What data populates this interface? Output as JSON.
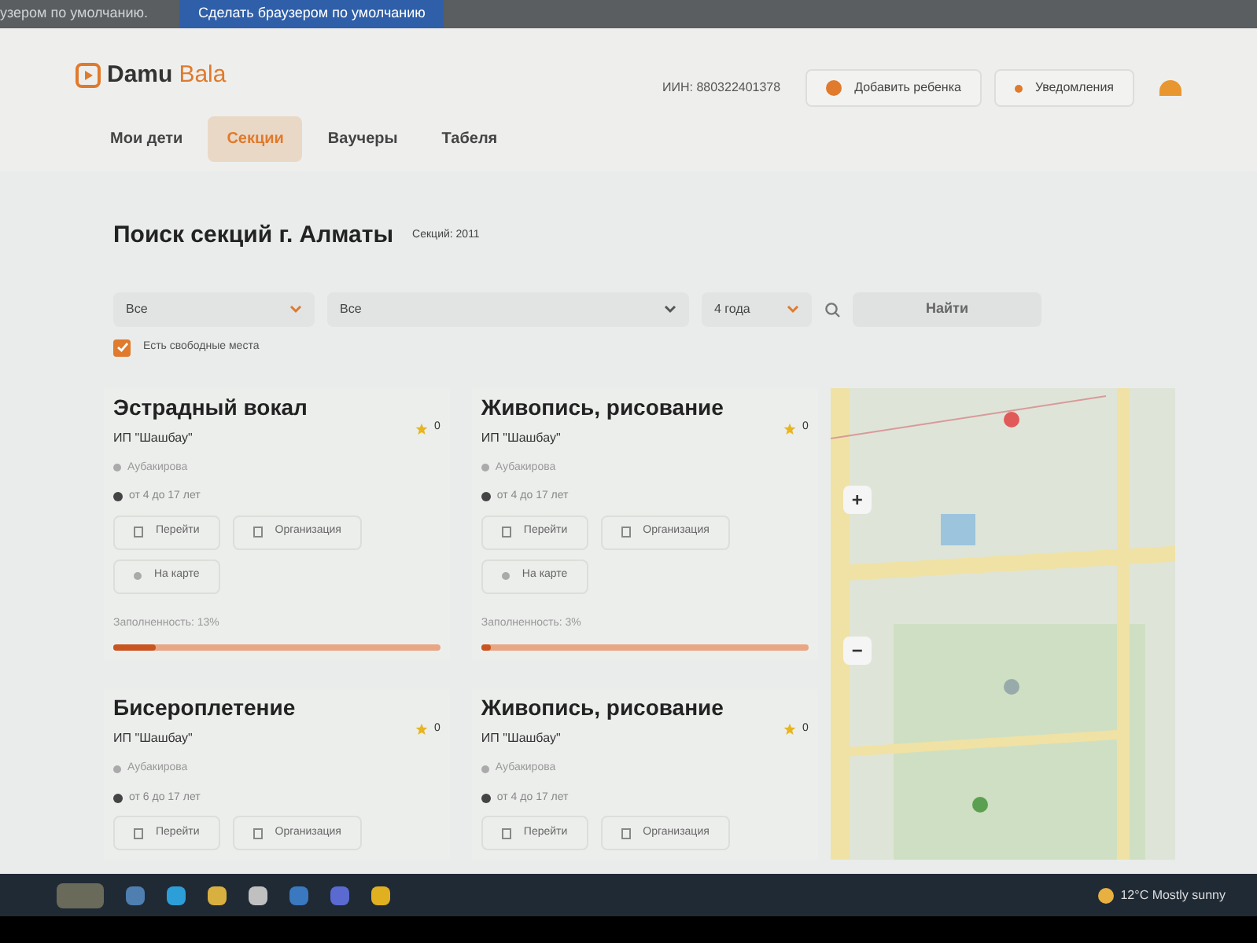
{
  "browser_infobar": {
    "message": "узером по умолчанию.",
    "button": "Сделать браузером по умолчанию"
  },
  "header": {
    "logo_first": "Damu",
    "logo_second": "Bala",
    "iin": "ИИН: 880322401378",
    "add_child": "Добавить ребенка",
    "notifications": "Уведомления"
  },
  "tabs": [
    {
      "label": "Мои дети",
      "selected": false
    },
    {
      "label": "Секции",
      "selected": true
    },
    {
      "label": "Ваучеры",
      "selected": false
    },
    {
      "label": "Табеля",
      "selected": false
    }
  ],
  "search": {
    "title": "Поиск секций г. Алматы",
    "count": "Секций: 2011",
    "filter_1": "Все",
    "filter_2": "Все",
    "age": "4 года",
    "button": "Найти",
    "free_places": {
      "label": "Есть свободные места",
      "checked": true
    }
  },
  "cards": [
    {
      "title": "Эстрадный вокал",
      "org": "ИП \"Шашбау\"",
      "rating": "0",
      "address": "Аубакирова",
      "age": "от 4 до 17 лет",
      "buttons": [
        "Перейти",
        "Организация",
        "На карте"
      ],
      "fill_label": "Заполненность: 13%",
      "level": 0.13
    },
    {
      "title": "Живопись, рисование",
      "org": "ИП \"Шашбау\"",
      "rating": "0",
      "address": "Аубакирова",
      "age": "от 4 до 17 лет",
      "buttons": [
        "Перейти",
        "Организация",
        "На карте"
      ],
      "fill_label": "Заполненность: 3%",
      "level": 0.03
    },
    {
      "title": "Бисероплетение",
      "org": "ИП \"Шашбау\"",
      "rating": "0",
      "address": "Аубакирова",
      "age": "от 6 до 17 лет",
      "buttons": [
        "Перейти",
        "Организация"
      ]
    },
    {
      "title": "Живопись, рисование",
      "org": "ИП \"Шашбау\"",
      "rating": "0",
      "address": "Аубакирова",
      "age": "от 4 до 17 лет",
      "buttons": [
        "Перейти",
        "Организация"
      ]
    }
  ],
  "map": {
    "zoom_in": "+",
    "zoom_out": "−"
  },
  "taskbar": {
    "weather": "12°C  Mostly sunny"
  }
}
